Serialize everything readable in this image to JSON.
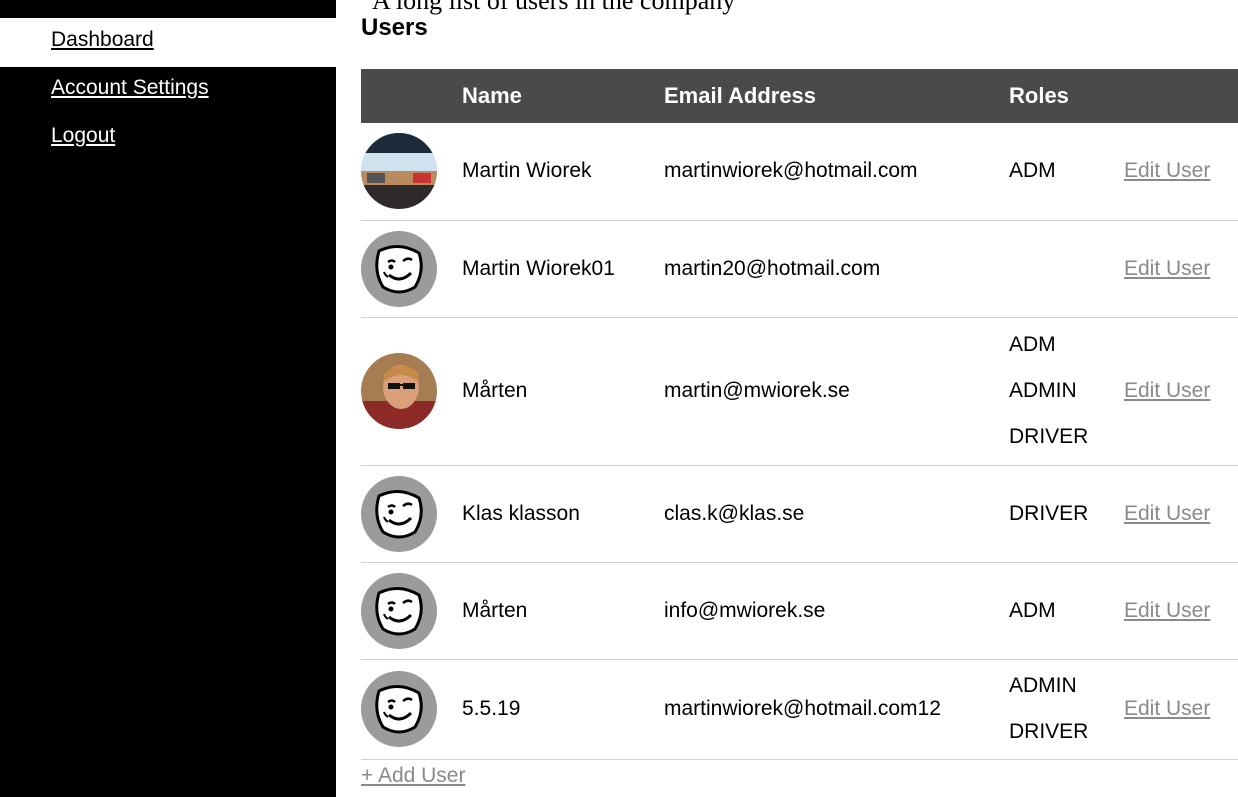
{
  "header": {
    "cut_text": "A long list of users in the company",
    "title": "Users"
  },
  "nav": {
    "dashboard": "Dashboard",
    "account_settings": "Account Settings",
    "logout": "Logout"
  },
  "table": {
    "headers": {
      "avatar": "",
      "name": "Name",
      "email": "Email Address",
      "roles": "Roles",
      "action": ""
    },
    "rows": [
      {
        "avatar": "photo-road",
        "name": "Martin Wiorek",
        "email": "martinwiorek@hotmail.com",
        "roles": [
          "ADM"
        ],
        "action": "Edit User"
      },
      {
        "avatar": "default-face",
        "name": "Martin Wiorek01",
        "email": "martin20@hotmail.com",
        "roles": [],
        "action": "Edit User"
      },
      {
        "avatar": "photo-person",
        "name": "Mårten",
        "email": "martin@mwiorek.se",
        "roles": [
          "ADM",
          "ADMIN",
          "DRIVER"
        ],
        "action": "Edit User"
      },
      {
        "avatar": "default-face",
        "name": "Klas klasson",
        "email": "clas.k@klas.se",
        "roles": [
          "DRIVER"
        ],
        "action": "Edit User"
      },
      {
        "avatar": "default-face",
        "name": "Mårten",
        "email": "info@mwiorek.se",
        "roles": [
          "ADM"
        ],
        "action": "Edit User"
      },
      {
        "avatar": "default-face",
        "name": "5.5.19",
        "email": "martinwiorek@hotmail.com12",
        "roles": [
          "ADMIN",
          "DRIVER"
        ],
        "action": "Edit User"
      }
    ]
  },
  "footer": {
    "add_user": "+ Add User"
  }
}
